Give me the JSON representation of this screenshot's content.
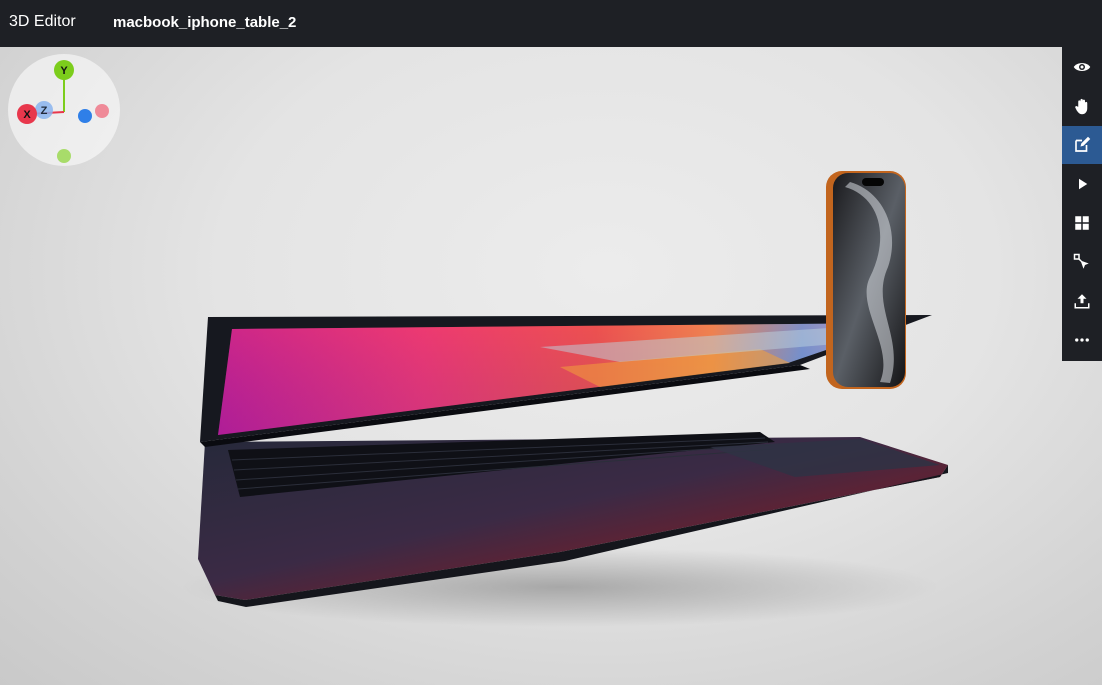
{
  "app": {
    "title": "3D Editor",
    "file_name": "macbook_iphone_table_2"
  },
  "gizmo": {
    "axes": [
      {
        "label": "Y",
        "color": "#7ccd1c"
      },
      {
        "label": "X",
        "color": "#e8374c"
      },
      {
        "label": "Z",
        "color": "#6fa8e8"
      }
    ]
  },
  "toolbar": {
    "tools": [
      {
        "name": "view",
        "icon": "eye-icon",
        "active": false
      },
      {
        "name": "pan",
        "icon": "hand-icon",
        "active": false
      },
      {
        "name": "edit",
        "icon": "edit-icon",
        "active": true
      },
      {
        "name": "play",
        "icon": "play-icon",
        "active": false
      },
      {
        "name": "layout",
        "icon": "grid-icon",
        "active": false
      },
      {
        "name": "transform",
        "icon": "move-cursor-icon",
        "active": false
      },
      {
        "name": "export",
        "icon": "upload-icon",
        "active": false
      },
      {
        "name": "more",
        "icon": "more-icon",
        "active": false
      }
    ],
    "active_color": "#2c5a93"
  }
}
